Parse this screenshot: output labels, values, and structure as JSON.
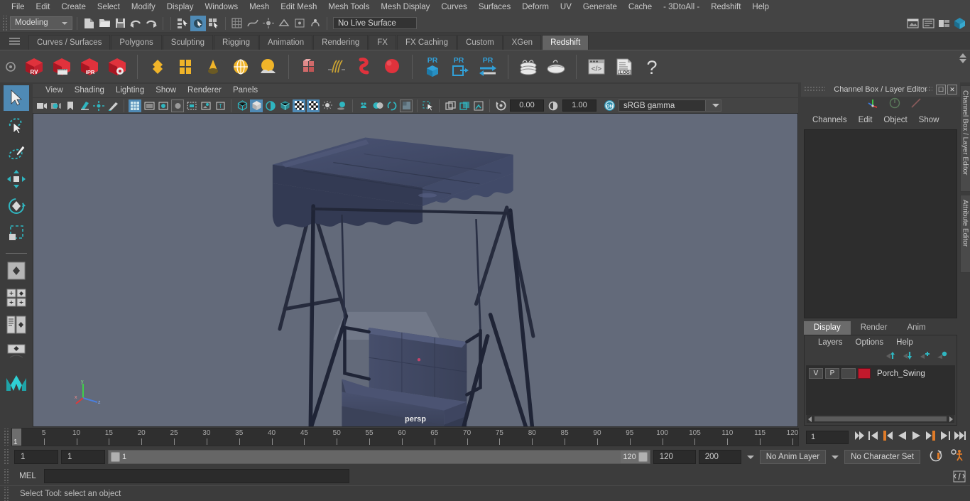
{
  "app": {
    "menus": [
      "File",
      "Edit",
      "Create",
      "Select",
      "Modify",
      "Display",
      "Windows",
      "Mesh",
      "Edit Mesh",
      "Mesh Tools",
      "Mesh Display",
      "Curves",
      "Surfaces",
      "Deform",
      "UV",
      "Generate",
      "Cache",
      "- 3DtoAll -",
      "Redshift",
      "Help"
    ]
  },
  "status_line": {
    "menu_set": "Modeling",
    "live_surface": "No Live Surface",
    "icons": [
      "new-scene-icon",
      "open-scene-icon",
      "save-scene-icon",
      "undo-icon",
      "redo-icon",
      "select-by-hierarchy-icon",
      "select-by-object-icon",
      "select-by-component-icon"
    ],
    "right_icons": [
      "render-view-icon",
      "render-settings-icon",
      "hypershade-icon",
      "outliner-icon"
    ]
  },
  "shelf": {
    "tabs": [
      "Curves / Surfaces",
      "Polygons",
      "Sculpting",
      "Rigging",
      "Animation",
      "Rendering",
      "FX",
      "FX Caching",
      "Custom",
      "XGen",
      "Redshift"
    ],
    "active_tab": "Redshift",
    "buttons": [
      {
        "name": "redshift-render-view",
        "label": "RV"
      },
      {
        "name": "redshift-render-sequence",
        "label": ""
      },
      {
        "name": "redshift-ipr",
        "label": "IPR"
      },
      {
        "name": "redshift-render-settings",
        "label": ""
      },
      {
        "name": "redshift-material-ball",
        "label": ""
      },
      {
        "name": "redshift-material-grid",
        "label": ""
      },
      {
        "name": "redshift-dome-light",
        "label": ""
      },
      {
        "name": "redshift-environment",
        "label": ""
      },
      {
        "name": "redshift-sun-sky",
        "label": ""
      },
      {
        "name": "redshift-proxy",
        "label": ""
      },
      {
        "name": "redshift-hair",
        "label": ""
      },
      {
        "name": "redshift-volume",
        "label": ""
      },
      {
        "name": "redshift-sphere",
        "label": ""
      },
      {
        "name": "redshift-pr-proxy",
        "label": "PR"
      },
      {
        "name": "redshift-pr-export",
        "label": "PR"
      },
      {
        "name": "redshift-pr-transfer",
        "label": "PR"
      },
      {
        "name": "redshift-bake-stack",
        "label": ""
      },
      {
        "name": "redshift-bake",
        "label": ""
      },
      {
        "name": "redshift-script-editor",
        "label": ""
      },
      {
        "name": "redshift-log",
        "label": ".LOG"
      },
      {
        "name": "redshift-help",
        "label": "?"
      }
    ]
  },
  "toolbox": {
    "items": [
      {
        "name": "select-tool",
        "selected": true
      },
      {
        "name": "lasso-select-tool",
        "selected": false
      },
      {
        "name": "paint-select-tool",
        "selected": false
      },
      {
        "name": "move-tool",
        "selected": false
      },
      {
        "name": "rotate-tool",
        "selected": false
      },
      {
        "name": "scale-tool",
        "selected": false
      },
      {
        "name": "last-tool-used",
        "selected": false
      },
      {
        "name": "single-perspective-layout",
        "selected": false
      },
      {
        "name": "four-view-layout",
        "selected": false
      },
      {
        "name": "outliner-persp-layout",
        "selected": false
      },
      {
        "name": "persp-graph-layout",
        "selected": false
      },
      {
        "name": "maya-logo",
        "selected": false
      }
    ]
  },
  "viewport": {
    "menus": [
      "View",
      "Shading",
      "Lighting",
      "Show",
      "Renderer",
      "Panels"
    ],
    "camera_label": "persp",
    "exposure": "0.00",
    "gamma": "1.00",
    "color_profile": "sRGB gamma",
    "color_manage_toggle": "ON",
    "background_color": "#636a7a",
    "model_color": "#3d4560",
    "model_name": "porch-swing-3d-model"
  },
  "right_panel": {
    "title": "Channel Box / Layer Editor",
    "menus": [
      "Channels",
      "Edit",
      "Object",
      "Show"
    ],
    "side_tabs": [
      "Channel Box / Layer Editor",
      "Attribute Editor"
    ],
    "layer_tabs": [
      "Display",
      "Render",
      "Anim"
    ],
    "active_layer_tab": "Display",
    "layer_menus": [
      "Layers",
      "Options",
      "Help"
    ],
    "layers": [
      {
        "visibility": "V",
        "playback": "P",
        "state": "",
        "color": "#c2192c",
        "name": "Porch_Swing"
      }
    ]
  },
  "timeline": {
    "ticks": [
      5,
      10,
      15,
      20,
      25,
      30,
      35,
      40,
      45,
      50,
      55,
      60,
      65,
      70,
      75,
      80,
      85,
      90,
      95,
      100,
      105,
      110,
      115,
      120
    ],
    "start": 1,
    "end": 120,
    "current_frame": "1",
    "playhead_label": "1",
    "transport": [
      "go-to-start",
      "step-back-key",
      "step-back-frame",
      "play-backwards",
      "play-forwards",
      "step-forward-frame",
      "step-forward-key",
      "go-to-end"
    ]
  },
  "range": {
    "anim_start": "1",
    "range_start": "1",
    "range_bar_start": "1",
    "range_bar_end": "120",
    "range_end": "120",
    "anim_end": "200",
    "anim_layer": "No Anim Layer",
    "character_set": "No Character Set",
    "auto_key_icon": "auto-keyframe-icon",
    "prefs_icon": "animation-preferences-icon"
  },
  "command_line": {
    "language": "MEL",
    "input_value": "",
    "output_value": "",
    "script_editor_icon": "script-editor-icon"
  },
  "help_line": {
    "text": "Select Tool: select an object"
  }
}
